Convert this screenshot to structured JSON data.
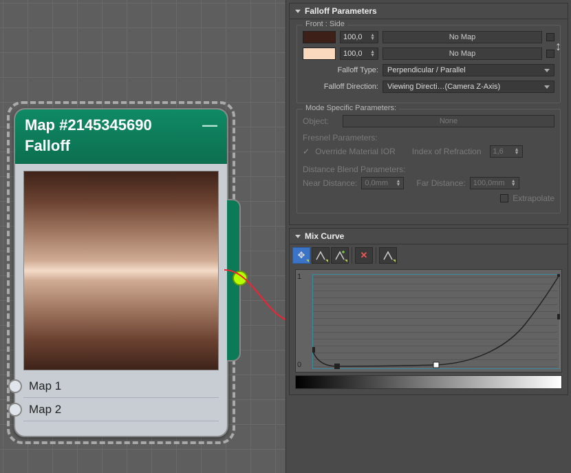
{
  "node": {
    "title": "Map #2145345690",
    "type": "Falloff",
    "slots": [
      "Map 1",
      "Map 2"
    ]
  },
  "panels": {
    "falloff": {
      "header": "Falloff Parameters",
      "front_side_group": "Front : Side",
      "row1": {
        "color": "#3d2018",
        "amount": "100,0",
        "map": "No Map"
      },
      "row2": {
        "color": "#fbd9be",
        "amount": "100,0",
        "map": "No Map"
      },
      "falloff_type_label": "Falloff Type:",
      "falloff_type_value": "Perpendicular / Parallel",
      "falloff_dir_label": "Falloff Direction:",
      "falloff_dir_value": "Viewing Directi…(Camera Z-Axis)",
      "mode_group": "Mode Specific Parameters:",
      "object_label": "Object:",
      "object_value": "None",
      "fresnel_label": "Fresnel Parameters:",
      "override_label": "Override Material IOR",
      "ior_label": "Index of Refraction",
      "ior_value": "1,6",
      "distance_label": "Distance Blend Parameters:",
      "near_label": "Near Distance:",
      "near_value": "0,0mm",
      "far_label": "Far Distance:",
      "far_value": "100,0mm",
      "extrapolate_label": "Extrapolate"
    },
    "mix": {
      "header": "Mix Curve",
      "y1": "1",
      "y0": "0"
    }
  },
  "chart_data": {
    "type": "line",
    "title": "Mix Curve",
    "xlabel": "",
    "ylabel": "",
    "xlim": [
      0,
      1
    ],
    "ylim": [
      0,
      1
    ],
    "series": [
      {
        "name": "curve",
        "x": [
          0.0,
          0.03,
          0.08,
          0.15,
          0.3,
          0.5,
          0.6,
          0.7,
          0.8,
          0.88,
          0.94,
          0.98,
          1.0
        ],
        "values": [
          0.2,
          0.09,
          0.04,
          0.03,
          0.03,
          0.035,
          0.05,
          0.1,
          0.22,
          0.42,
          0.65,
          0.88,
          1.0
        ]
      }
    ],
    "control_points": [
      {
        "x": 0.0,
        "y": 0.2
      },
      {
        "x": 0.1,
        "y": 0.03
      },
      {
        "x": 0.5,
        "y": 0.035
      },
      {
        "x": 1.0,
        "y": 1.0
      }
    ],
    "tangent_handle": {
      "x": 1.0,
      "y": 0.55
    }
  }
}
